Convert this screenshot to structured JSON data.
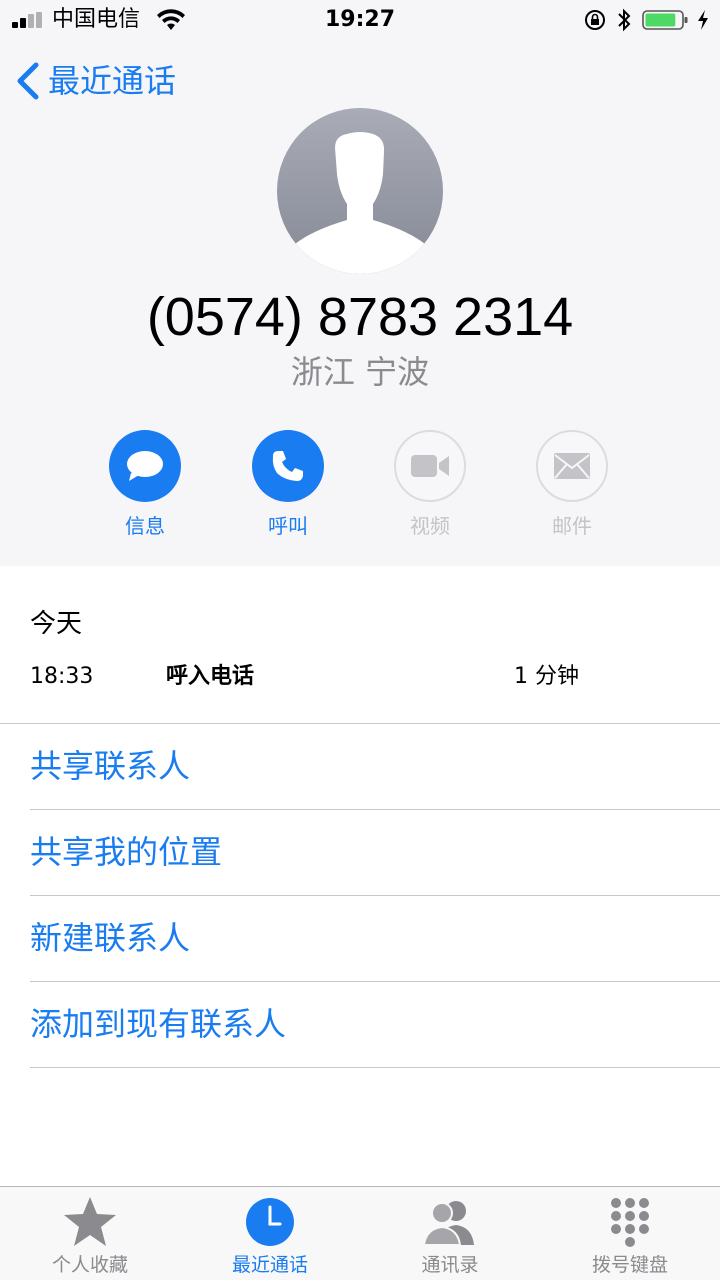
{
  "status_bar": {
    "carrier": "中国电信",
    "time": "19:27"
  },
  "header": {
    "back_label": "最近通话",
    "phone_number": "(0574) 8783 2314",
    "location": "浙江 宁波"
  },
  "actions": [
    {
      "label": "信息",
      "icon": "message-icon",
      "enabled": true
    },
    {
      "label": "呼叫",
      "icon": "phone-icon",
      "enabled": true
    },
    {
      "label": "视频",
      "icon": "video-icon",
      "enabled": false
    },
    {
      "label": "邮件",
      "icon": "mail-icon",
      "enabled": false
    }
  ],
  "recent_calls": {
    "date": "今天",
    "entries": [
      {
        "time": "18:33",
        "type": "呼入电话",
        "duration": "1 分钟"
      }
    ]
  },
  "options": [
    {
      "label": "共享联系人"
    },
    {
      "label": "共享我的位置"
    },
    {
      "label": "新建联系人"
    },
    {
      "label": "添加到现有联系人"
    }
  ],
  "tab_bar": {
    "active_index": 1,
    "tabs": [
      {
        "label": "个人收藏",
        "icon": "star-icon"
      },
      {
        "label": "最近通话",
        "icon": "clock-icon"
      },
      {
        "label": "通讯录",
        "icon": "contacts-icon"
      },
      {
        "label": "拨号键盘",
        "icon": "keypad-icon"
      }
    ]
  },
  "colors": {
    "accent": "#1a7cf1",
    "header_bg": "#f6f6f8",
    "disabled": "#c4c4c8",
    "battery": "#4cd964"
  },
  "battery_level": 0.85
}
